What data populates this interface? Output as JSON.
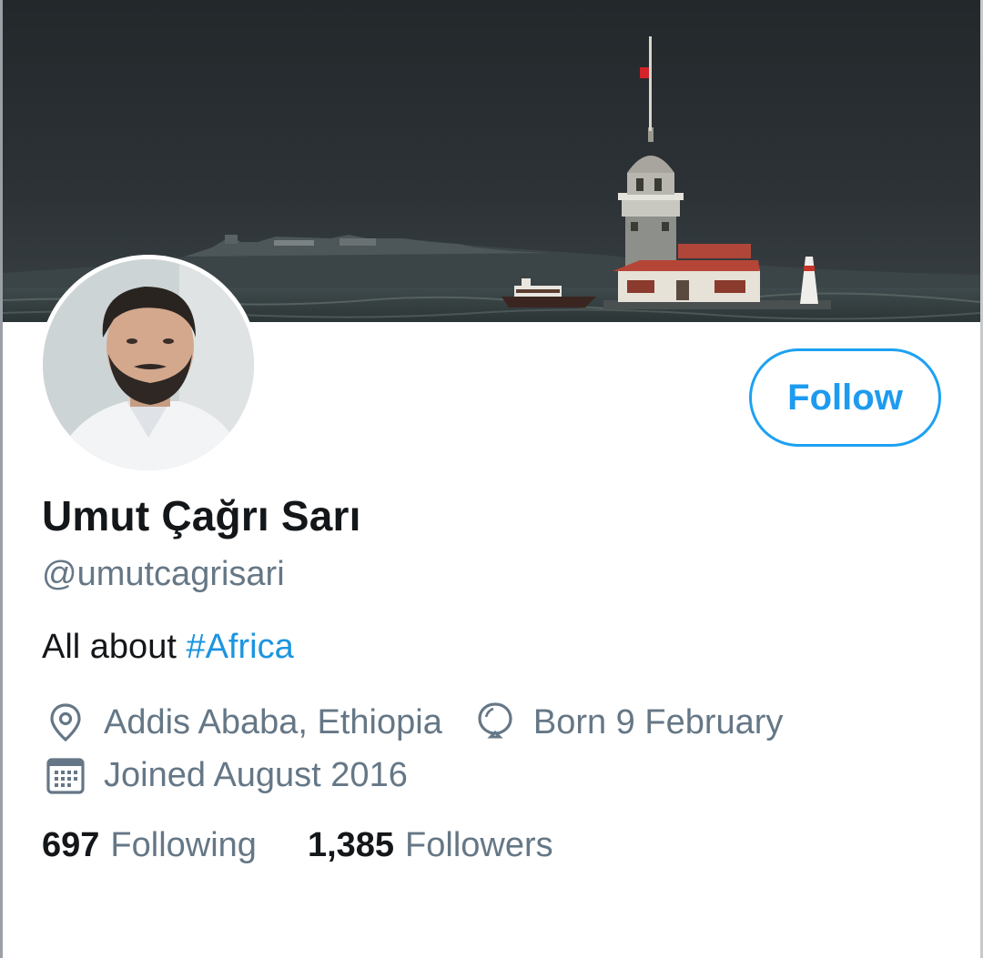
{
  "profile": {
    "display_name": "Umut Çağrı Sarı",
    "handle": "@umutcagrisari",
    "bio_text": "All about ",
    "bio_hashtag": "#Africa",
    "location": "Addis Ababa, Ethiopia",
    "birthday": "Born 9 February",
    "joined": "Joined August 2016",
    "following_count": "697",
    "following_label": "Following",
    "followers_count": "1,385",
    "followers_label": "Followers"
  },
  "actions": {
    "follow_label": "Follow"
  },
  "icons": {
    "location": "location-pin-icon",
    "birthday": "balloon-icon",
    "joined": "calendar-icon"
  },
  "colors": {
    "accent": "#1da1f2",
    "hashtag": "#1b95e0",
    "text_primary": "#14171a",
    "text_secondary": "#657786"
  }
}
